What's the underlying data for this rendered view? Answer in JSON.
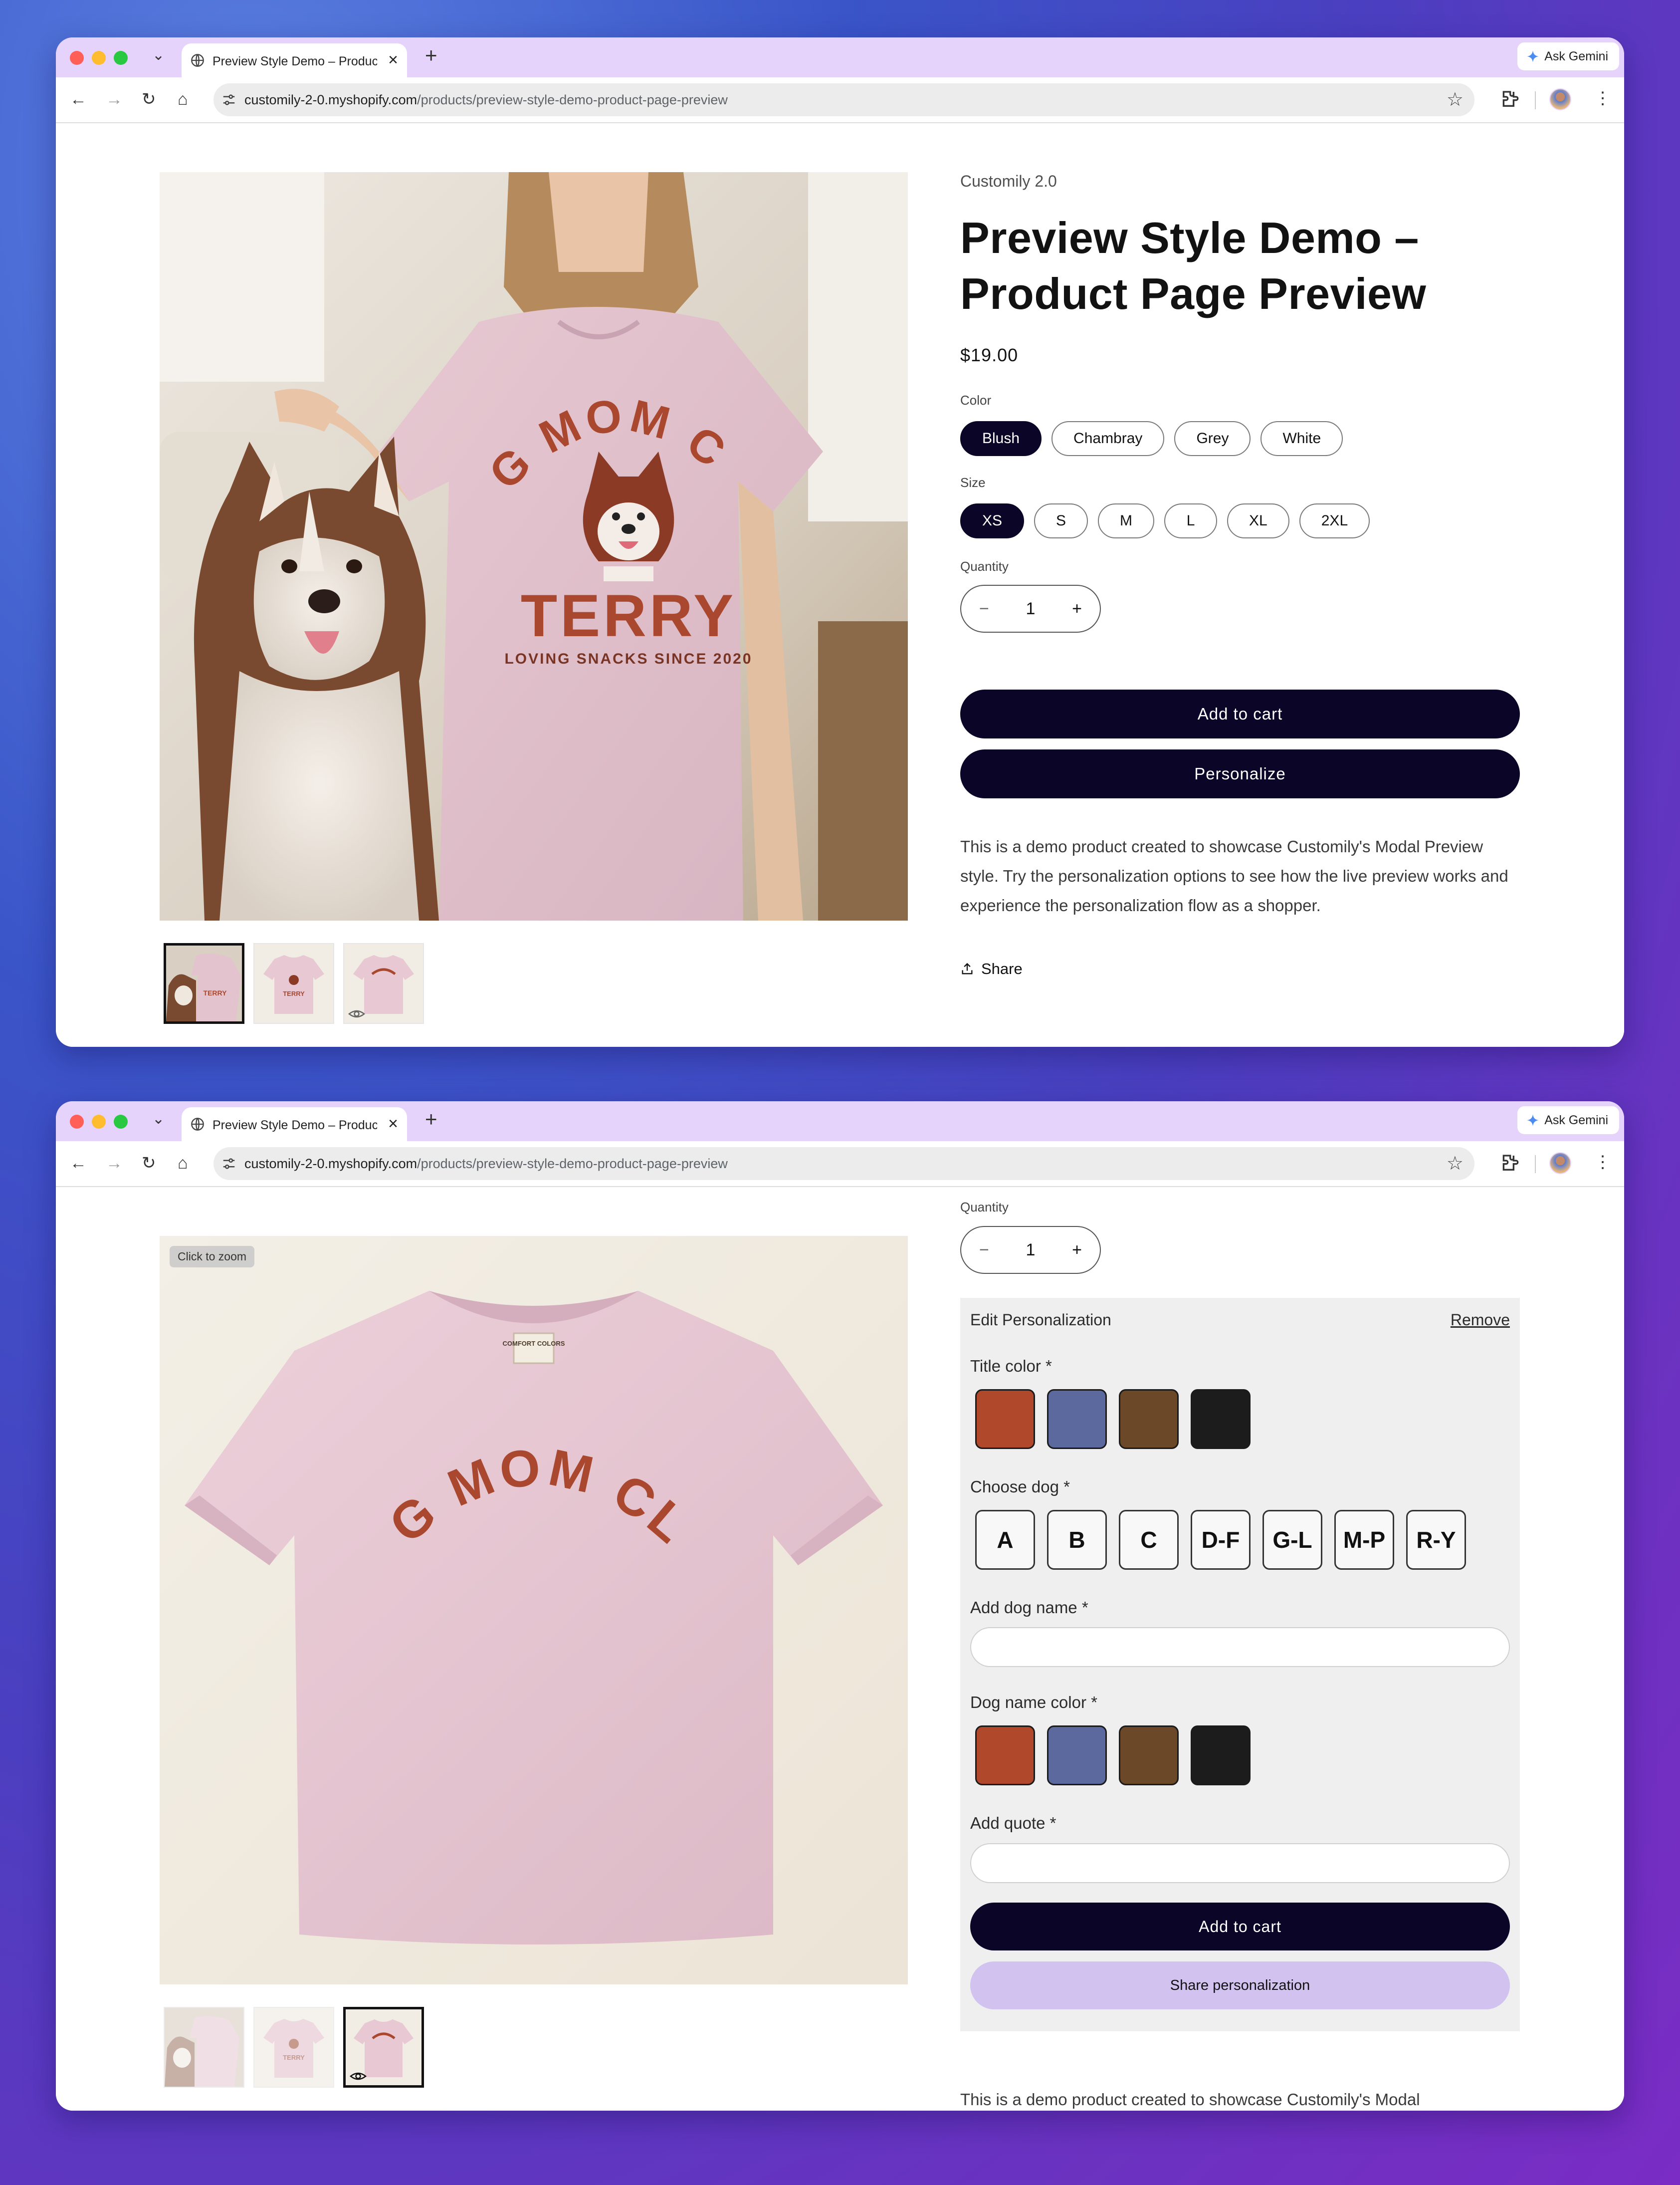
{
  "browser": {
    "tab_title": "Preview Style Demo – Produc",
    "url_host": "customily-2-0.myshopify.com",
    "url_path": "/products/preview-style-demo-product-page-preview",
    "ask_gemini": "Ask Gemini"
  },
  "product": {
    "vendor": "Customily 2.0",
    "title_line1": "Preview Style Demo –",
    "title_line2": "Product Page Preview",
    "price": "$19.00",
    "color_label": "Color",
    "colors": [
      "Blush",
      "Chambray",
      "Grey",
      "White"
    ],
    "selected_color": "Blush",
    "size_label": "Size",
    "sizes": [
      "XS",
      "S",
      "M",
      "L",
      "XL",
      "2XL"
    ],
    "selected_size": "XS",
    "quantity_label": "Quantity",
    "quantity_minus": "−",
    "quantity_value": "1",
    "quantity_plus": "+",
    "add_to_cart": "Add to cart",
    "personalize": "Personalize",
    "description": "This is a demo product created to showcase Customily's Modal Preview style. Try the personalization options to see how the live preview works and experience the personalization flow as a shopper.",
    "description_cutoff": "This is a demo product created to showcase Customily's Modal",
    "share": "Share"
  },
  "shirt_print": {
    "line1": "DOG MOM CLUB",
    "name": "TERRY",
    "tagline": "LOVING SNACKS SINCE 2020",
    "label_tag": "COMFORT COLORS"
  },
  "gallery": {
    "zoom_hint": "Click to zoom"
  },
  "personalization": {
    "header": "Edit Personalization",
    "remove": "Remove",
    "title_color_label": "Title color *",
    "swatch_colors": [
      "#b0492b",
      "#5b699e",
      "#6b4828",
      "#1d1c1d"
    ],
    "choose_dog_label": "Choose dog *",
    "dog_options": [
      "A",
      "B",
      "C",
      "D-F",
      "G-L",
      "M-P",
      "R-Y"
    ],
    "dog_name_label": "Add dog name *",
    "dog_name_value": "",
    "dog_name_color_label": "Dog name color *",
    "quote_label": "Add quote *",
    "quote_value": "",
    "add_to_cart": "Add to cart",
    "share_personalization": "Share personalization"
  },
  "colors": {
    "accent_dark": "#0b0627",
    "tab_bar": "#e6d3fb",
    "share_button": "#d2c2ef",
    "shirt_pink": "#e8c9d3",
    "print_rust": "#a9472f"
  }
}
